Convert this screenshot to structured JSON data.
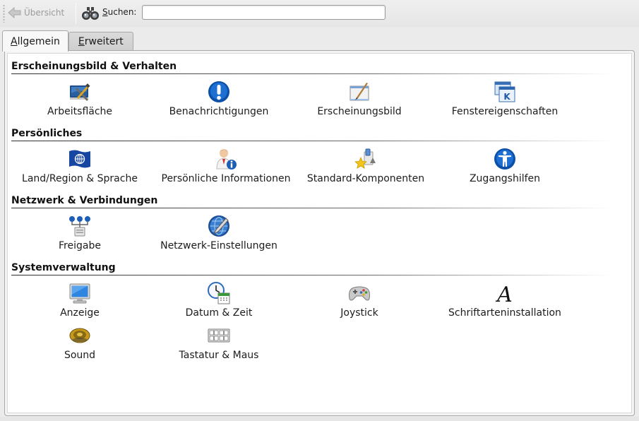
{
  "toolbar": {
    "back_label": "Übersicht",
    "search_label_prefix": "S",
    "search_label_rest": "uchen:",
    "search_value": ""
  },
  "tabs": [
    {
      "mnemonic": "A",
      "rest": "llgemein",
      "active": true
    },
    {
      "mnemonic": "E",
      "rest": "rweitert",
      "active": false
    }
  ],
  "sections": [
    {
      "title": "Erscheinungsbild & Verhalten",
      "items": [
        {
          "label": "Arbeitsfläche",
          "icon": "desktop-tools-icon"
        },
        {
          "label": "Benachrichtigungen",
          "icon": "exclamation-icon"
        },
        {
          "label": "Erscheinungsbild",
          "icon": "appearance-brush-icon"
        },
        {
          "label": "Fenstereigenschaften",
          "icon": "window-properties-icon"
        }
      ]
    },
    {
      "title": "Persönliches",
      "items": [
        {
          "label": "Land/Region & Sprache",
          "icon": "flag-globe-icon"
        },
        {
          "label": "Persönliche Informationen",
          "icon": "user-info-icon"
        },
        {
          "label": "Standard-Komponenten",
          "icon": "default-components-icon"
        },
        {
          "label": "Zugangshilfen",
          "icon": "accessibility-icon"
        }
      ]
    },
    {
      "title": "Netzwerk & Verbindungen",
      "items": [
        {
          "label": "Freigabe",
          "icon": "network-share-icon"
        },
        {
          "label": "Netzwerk-Einstellungen",
          "icon": "network-settings-icon"
        }
      ]
    },
    {
      "title": "Systemverwaltung",
      "items": [
        {
          "label": "Anzeige",
          "icon": "monitor-icon"
        },
        {
          "label": "Datum & Zeit",
          "icon": "clock-calendar-icon"
        },
        {
          "label": "Joystick",
          "icon": "gamepad-icon"
        },
        {
          "label": "Schriftarteninstallation",
          "icon": "font-icon"
        },
        {
          "label": "Sound",
          "icon": "speaker-icon"
        },
        {
          "label": "Tastatur & Maus",
          "icon": "keyboard-icon"
        }
      ]
    }
  ]
}
